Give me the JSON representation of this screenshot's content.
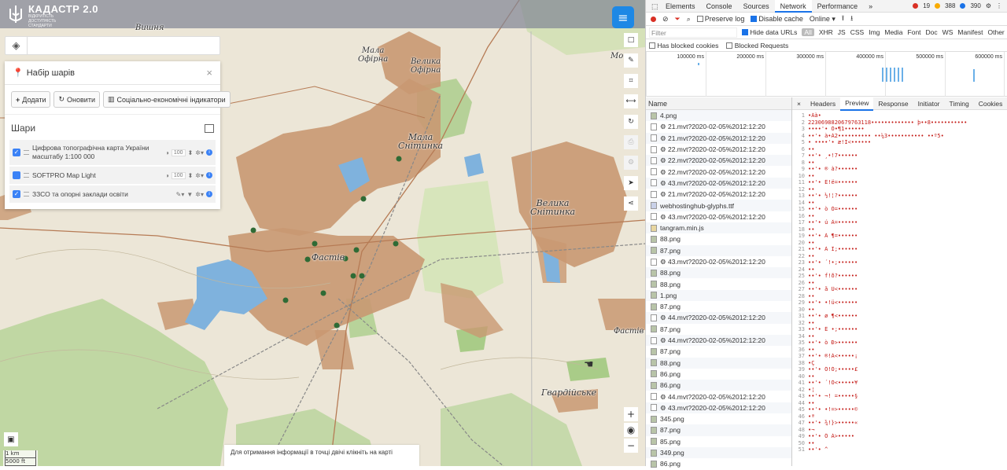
{
  "app": {
    "logo_title": "КАДАСТР 2.0",
    "logo_subtitle_1": "ВІДКРИТІСТЬ",
    "logo_subtitle_2": "ДОСТУПНІСТЬ",
    "logo_subtitle_3": "СТАНДАРТИ"
  },
  "panel": {
    "title": "Набір шарів",
    "close": "×",
    "actions": [
      {
        "label": "Додати",
        "icon": "plus-icon"
      },
      {
        "label": "Оновити",
        "icon": "refresh-icon"
      },
      {
        "label": "Соціально-економічні індикатори",
        "icon": "bar-chart-icon"
      }
    ],
    "layers_title": "Шари",
    "layers": [
      {
        "name": "Цифрова топографічна карта України масштабу 1:100 000",
        "opacity": "100",
        "checked": true
      },
      {
        "name": "SOFTPRO Map Light",
        "opacity": "100",
        "checked": false
      },
      {
        "name": "ЗЗСО та опорні заклади освіти",
        "opacity": "",
        "checked": true
      }
    ]
  },
  "map": {
    "labels": [
      {
        "text": "Вишня"
      },
      {
        "text": "Мала\nОфірна"
      },
      {
        "text": "Велика\nОфірна"
      },
      {
        "text": "Мала\nСнітинка"
      },
      {
        "text": "Велика\nСнітинка"
      },
      {
        "text": "Фастів"
      },
      {
        "text": "Гвардійське"
      },
      {
        "text": "Фастів"
      },
      {
        "text": "Мо"
      }
    ],
    "scale_km": "1 km",
    "scale_ft": "5000 ft",
    "hint": "Для отримання інформації в точці двічі клікніть на карті"
  },
  "devtools": {
    "tabs": [
      "Elements",
      "Console",
      "Sources",
      "Network",
      "Performance",
      "»"
    ],
    "active_tab": "Network",
    "errors": "19",
    "warnings": "388",
    "info": "390",
    "toolbar": {
      "preserve_log": "Preserve log",
      "disable_cache": "Disable cache",
      "throttle": "Online"
    },
    "filter_placeholder": "Filter",
    "hide_data_urls": "Hide data URLs",
    "filter_types": [
      "All",
      "XHR",
      "JS",
      "CSS",
      "Img",
      "Media",
      "Font",
      "Doc",
      "WS",
      "Manifest",
      "Other"
    ],
    "has_blocked_cookies": "Has blocked cookies",
    "blocked_requests": "Blocked Requests",
    "timeline_ticks": [
      "100000 ms",
      "200000 ms",
      "300000 ms",
      "400000 ms",
      "500000 ms",
      "600000 ms"
    ],
    "name_header": "Name",
    "requests": [
      {
        "name": "4.png",
        "type": "img"
      },
      {
        "name": "⚙ 21.mvt?2020-02-05%2012:12:20",
        "type": "mvt"
      },
      {
        "name": "⚙ 21.mvt?2020-02-05%2012:12:20",
        "type": "mvt"
      },
      {
        "name": "⚙ 22.mvt?2020-02-05%2012:12:20",
        "type": "mvt"
      },
      {
        "name": "⚙ 22.mvt?2020-02-05%2012:12:20",
        "type": "mvt"
      },
      {
        "name": "⚙ 22.mvt?2020-02-05%2012:12:20",
        "type": "mvt"
      },
      {
        "name": "⚙ 43.mvt?2020-02-05%2012:12:20",
        "type": "mvt"
      },
      {
        "name": "⚙ 21.mvt?2020-02-05%2012:12:20",
        "type": "mvt"
      },
      {
        "name": "webhostinghub-glyphs.ttf",
        "type": "ttf"
      },
      {
        "name": "⚙ 43.mvt?2020-02-05%2012:12:20",
        "type": "mvt"
      },
      {
        "name": "tangram.min.js",
        "type": "js"
      },
      {
        "name": "88.png",
        "type": "img"
      },
      {
        "name": "87.png",
        "type": "img"
      },
      {
        "name": "⚙ 43.mvt?2020-02-05%2012:12:20",
        "type": "mvt"
      },
      {
        "name": "88.png",
        "type": "img"
      },
      {
        "name": "88.png",
        "type": "img"
      },
      {
        "name": "1.png",
        "type": "img"
      },
      {
        "name": "87.png",
        "type": "img"
      },
      {
        "name": "⚙ 44.mvt?2020-02-05%2012:12:20",
        "type": "mvt"
      },
      {
        "name": "87.png",
        "type": "img"
      },
      {
        "name": "⚙ 44.mvt?2020-02-05%2012:12:20",
        "type": "mvt"
      },
      {
        "name": "87.png",
        "type": "img"
      },
      {
        "name": "88.png",
        "type": "img"
      },
      {
        "name": "86.png",
        "type": "img"
      },
      {
        "name": "86.png",
        "type": "img"
      },
      {
        "name": "⚙ 44.mvt?2020-02-05%2012:12:20",
        "type": "mvt"
      },
      {
        "name": "⚙ 43.mvt?2020-02-05%2012:12:20",
        "type": "mvt"
      },
      {
        "name": "345.png",
        "type": "img"
      },
      {
        "name": "87.png",
        "type": "img"
      },
      {
        "name": "85.png",
        "type": "img"
      },
      {
        "name": "349.png",
        "type": "img"
      },
      {
        "name": "86.png",
        "type": "img"
      }
    ],
    "preview_tabs": [
      "×",
      "Headers",
      "Preview",
      "Response",
      "Initiator",
      "Timing",
      "Cookies"
    ],
    "active_preview_tab": "Preview",
    "preview_lines": [
      "•Äà•",
      "2230698820679763118•••••••••••••    þ••8•••••••••••",
      "••••'•   Ó•¶1••••••",
      "••'•    à•À2••••••••••    ••¼3•••••••••••    ••º5•",
      "• ••••'•  æ!I<••••••",
      "••",
      "••'•      ¸•!7••••••",
      "••",
      "••'•    ®  à?••••••",
      "••",
      "••'•      Ë!ë=••••••",
      "••",
      "••'•     ½!¦?••••••",
      "••",
      "••'•    ò  Ò=••••••",
      "••",
      "••'•    ú  Â=••••••",
      "••",
      "••'•    À  ¶=••••••",
      "••",
      "••'•    À  Ï;••••••",
      "••",
      "••'•      ´!•;••••••",
      "••",
      "••'•      f!ð?••••••",
      "••",
      "••'•    å  Ü<••••••",
      "••",
      "••'•     •!ü<••••••",
      "••",
      "••'•    ø  ¶<••••••",
      "••",
      "••'•    Ë  •;••••••",
      "••",
      "••'•    ò  Ð>••••••",
      "••",
      "••'•     ®!À<•••••¡",
      "•Ç",
      "••'•     Ö!Ò;•••••£",
      "••",
      "••'•      ´!Ó<•••••¥",
      "•¦",
      "••'•     ¬! =•••••§",
      "••",
      "••'•     •!=>•••••©",
      "•ª",
      "••'•     ¾!}>•••••«",
      "•¬",
      "••'•     Ô  À>•••••",
      "••",
      "••'•     ^"
    ]
  }
}
